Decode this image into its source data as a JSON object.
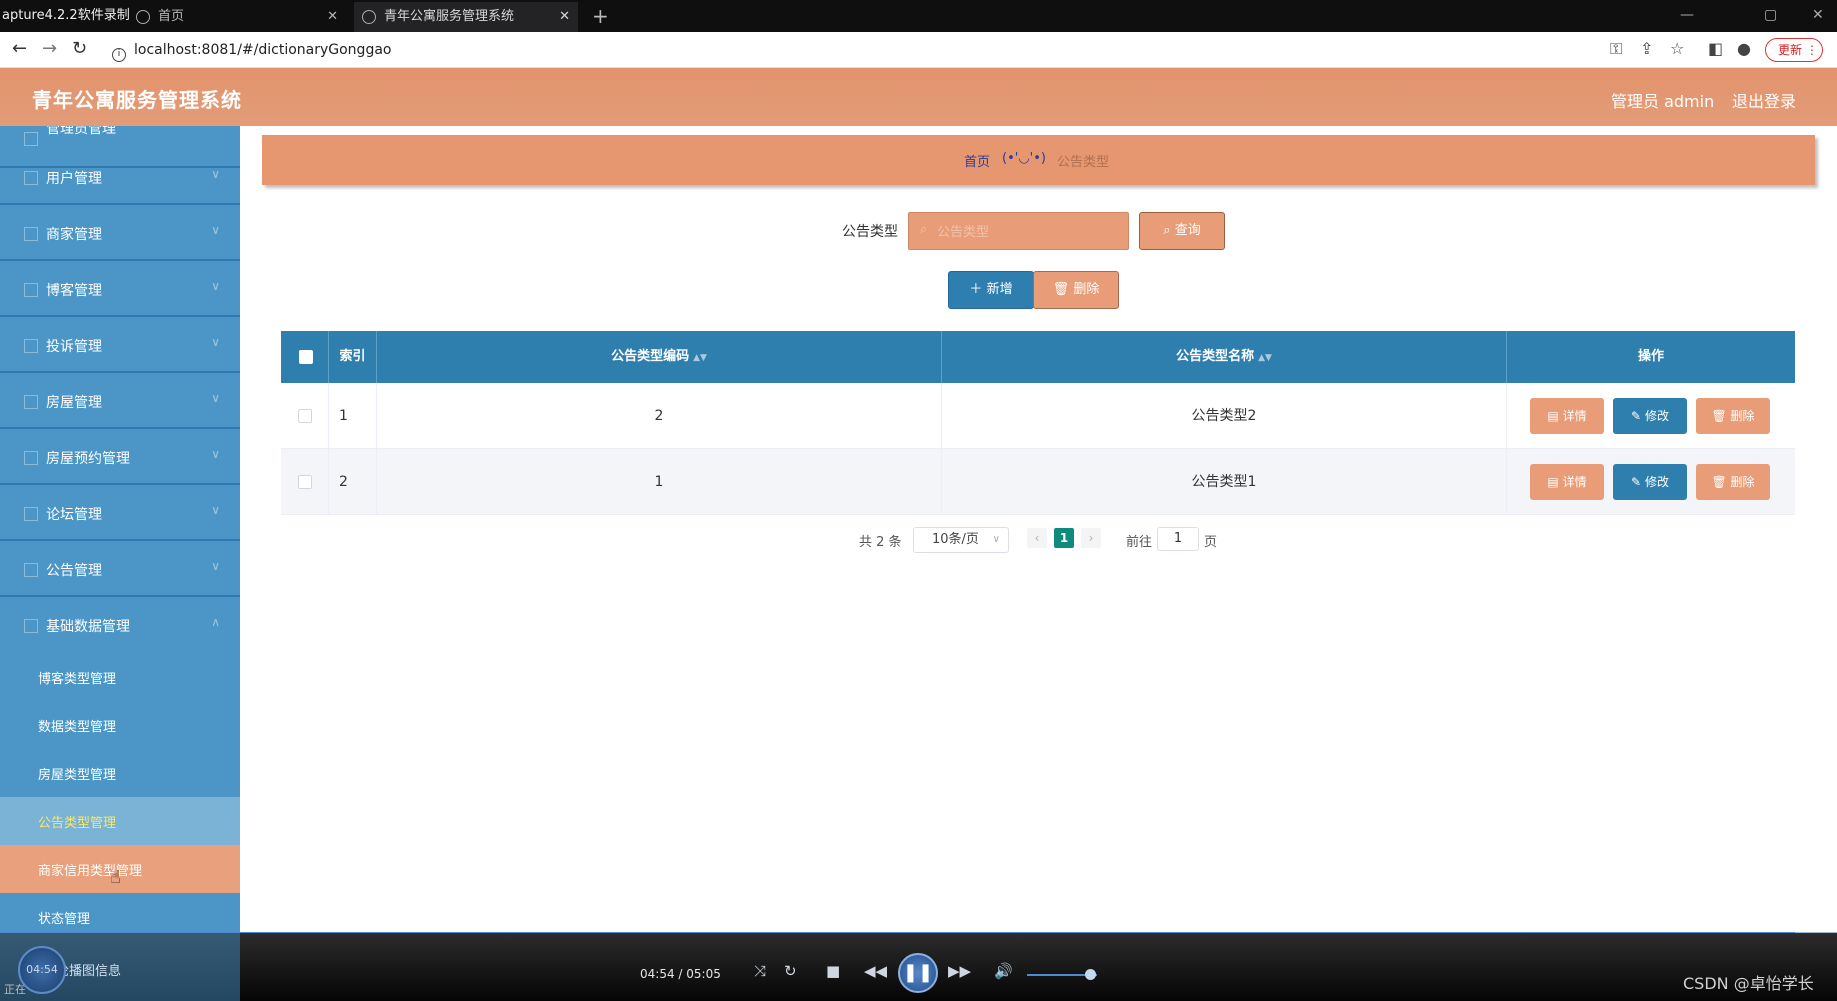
{
  "browser": {
    "recorder_title": "apture4.2.2软件录制",
    "tabs": [
      {
        "label": "首页",
        "active": false
      },
      {
        "label": "青年公寓服务管理系统",
        "active": true
      }
    ],
    "url": "localhost:8081/#/dictionaryGonggao",
    "update_label": "更新"
  },
  "header": {
    "title": "青年公寓服务管理系统",
    "user_label": "管理员 admin",
    "logout_label": "退出登录"
  },
  "sidebar": {
    "partial_top_label": "管理员管理",
    "items": [
      {
        "label": "用户管理",
        "icon": "user-icon"
      },
      {
        "label": "商家管理",
        "icon": "shop-icon"
      },
      {
        "label": "博客管理",
        "icon": "blog-icon"
      },
      {
        "label": "投诉管理",
        "icon": "complaint-icon"
      },
      {
        "label": "房屋管理",
        "icon": "house-icon"
      },
      {
        "label": "房屋预约管理",
        "icon": "calendar-icon"
      },
      {
        "label": "论坛管理",
        "icon": "forum-icon"
      },
      {
        "label": "公告管理",
        "icon": "notice-icon"
      },
      {
        "label": "基础数据管理",
        "icon": "database-icon",
        "expanded": true
      }
    ],
    "sub_items": [
      {
        "label": "博客类型管理"
      },
      {
        "label": "数据类型管理"
      },
      {
        "label": "房屋类型管理"
      },
      {
        "label": "公告类型管理",
        "active": true
      },
      {
        "label": "商家信用类型管理",
        "hover": true
      },
      {
        "label": "状态管理"
      }
    ],
    "partial_bottom_label": "轮播图信息"
  },
  "breadcrumb": {
    "home": "首页",
    "face": "(•'◡'•)",
    "current": "公告类型"
  },
  "search": {
    "label": "公告类型",
    "placeholder": "公告类型",
    "value": "",
    "query_label": "查询"
  },
  "actions": {
    "add_label": "新增",
    "delete_label": "删除"
  },
  "table": {
    "columns": [
      "索引",
      "公告类型编码",
      "公告类型名称",
      "操作"
    ],
    "rows": [
      {
        "index": "1",
        "code": "2",
        "name": "公告类型2"
      },
      {
        "index": "2",
        "code": "1",
        "name": "公告类型1"
      }
    ],
    "row_actions": {
      "detail": "详情",
      "edit": "修改",
      "remove": "删除"
    }
  },
  "pagination": {
    "total_text": "共 2 条",
    "page_size": "10条/页",
    "current_page": "1",
    "goto_prefix": "前往",
    "goto_value": "1",
    "goto_suffix": "页"
  },
  "player": {
    "time": "04:54 / 05:05",
    "badge_time": "04:54",
    "watermark": "CSDN @卓怡学长",
    "status_text": "正在"
  },
  "colors": {
    "header": "#e3936c",
    "sidebar": "#4b96c7",
    "primary": "#2f7fae",
    "accent": "#e89c78",
    "pager_active": "#0f8b7e"
  }
}
